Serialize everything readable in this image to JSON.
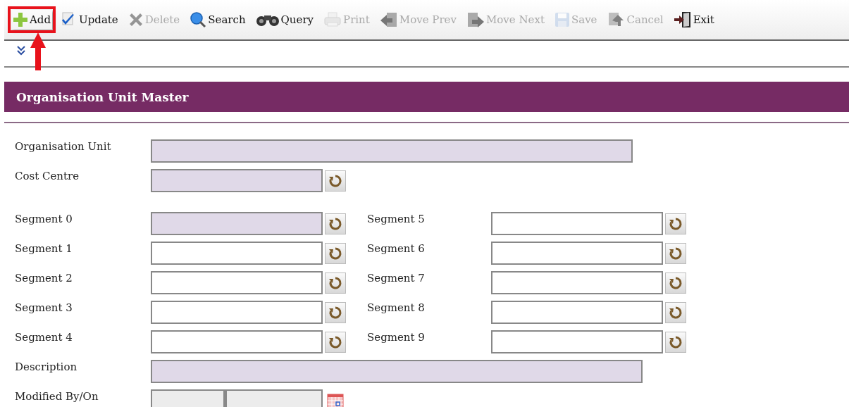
{
  "toolbar": {
    "items": [
      {
        "label": "Add",
        "disabled": false,
        "highlighted": true
      },
      {
        "label": "Update",
        "disabled": false,
        "highlighted": false
      },
      {
        "label": "Delete",
        "disabled": true,
        "highlighted": false
      },
      {
        "label": "Search",
        "disabled": false,
        "highlighted": false
      },
      {
        "label": "Query",
        "disabled": false,
        "highlighted": false
      },
      {
        "label": "Print",
        "disabled": true,
        "highlighted": false
      },
      {
        "label": "Move Prev",
        "disabled": true,
        "highlighted": false
      },
      {
        "label": "Move Next",
        "disabled": true,
        "highlighted": false
      },
      {
        "label": "Save",
        "disabled": true,
        "highlighted": false
      },
      {
        "label": "Cancel",
        "disabled": true,
        "highlighted": false
      },
      {
        "label": "Exit",
        "disabled": false,
        "highlighted": false
      }
    ]
  },
  "form": {
    "title": "Organisation Unit Master",
    "top_fields": [
      {
        "label": "Organisation Unit",
        "kind": "wide",
        "required": true,
        "disabled": false
      },
      {
        "label": "Cost Centre",
        "kind": "lookup",
        "required": true,
        "disabled": false
      }
    ],
    "segments": [
      {
        "left": {
          "label": "Segment 0",
          "required": true
        },
        "right": {
          "label": "Segment 5",
          "required": false
        }
      },
      {
        "left": {
          "label": "Segment 1",
          "required": false
        },
        "right": {
          "label": "Segment 6",
          "required": false
        }
      },
      {
        "left": {
          "label": "Segment 2",
          "required": false
        },
        "right": {
          "label": "Segment 7",
          "required": false
        }
      },
      {
        "left": {
          "label": "Segment 3",
          "required": false
        },
        "right": {
          "label": "Segment 8",
          "required": false
        }
      },
      {
        "left": {
          "label": "Segment 4",
          "required": false
        },
        "right": {
          "label": "Segment 9",
          "required": false
        }
      }
    ],
    "bottom_fields": [
      {
        "label": "Description",
        "kind": "wide",
        "required": true,
        "disabled": false
      },
      {
        "label": "Modified By/On",
        "kind": "split",
        "required": false,
        "disabled": true
      }
    ]
  }
}
